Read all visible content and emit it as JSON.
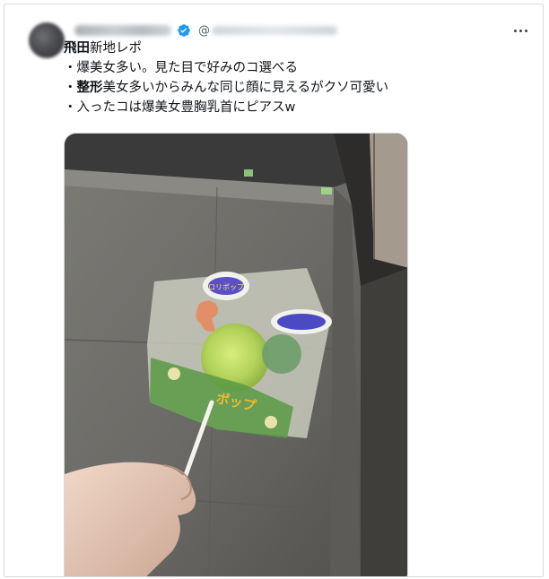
{
  "post": {
    "at_symbol": "@",
    "lines": [
      {
        "bold": "飛田",
        "rest": "新地レポ"
      },
      {
        "bold": "",
        "rest": "・爆美女多い。見た目で好みのコ選べる"
      },
      {
        "prefix": "・",
        "bold": "整形",
        "rest": "美女多いからみんな同じ顔に見えるがクソ可愛い"
      },
      {
        "bold": "",
        "rest": "・入ったコは爆美女豊胸乳首にピアスw"
      }
    ],
    "candy_label_top": "ロリポップ",
    "candy_label_bottom": "ポップ"
  },
  "icons": {
    "verified": "verified-badge-icon",
    "more": "more-options-icon"
  },
  "colors": {
    "verified_blue": "#1d9bf0",
    "handle_gray": "#536471",
    "border": "#cfd9de"
  }
}
